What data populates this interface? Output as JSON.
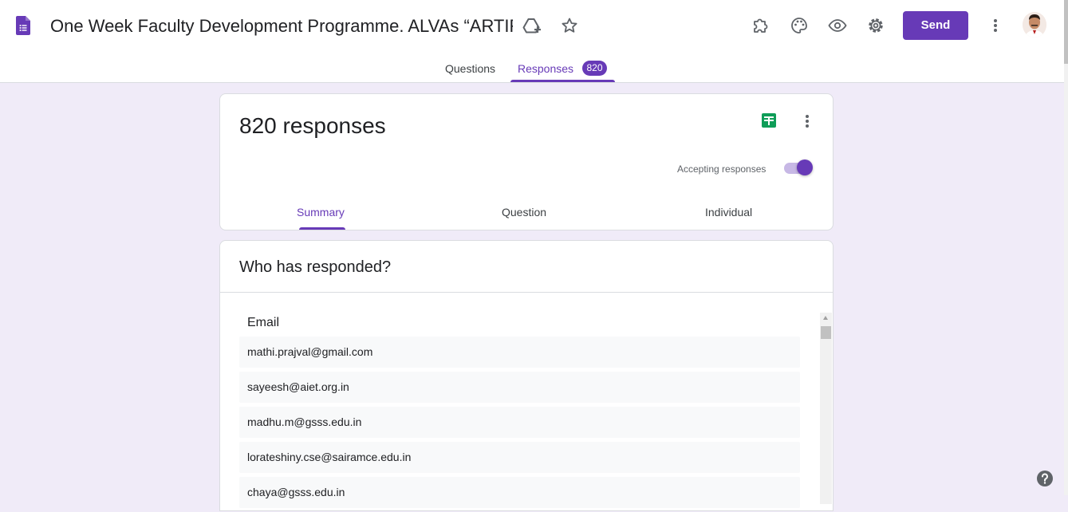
{
  "header": {
    "doc_title": "One Week Faculty Development Programme.  ALVAs “ARTIFICIAL INTELLIGENCE”",
    "send_label": "Send",
    "icons": [
      "google-forms-icon",
      "drive-add-icon",
      "star-icon",
      "addon-puzzle-icon",
      "palette-icon",
      "preview-eye-icon",
      "settings-gear-icon",
      "more-vert-icon",
      "avatar"
    ]
  },
  "tabs": {
    "questions": "Questions",
    "responses": "Responses",
    "responses_count": "820"
  },
  "summary_card": {
    "title": "820 responses",
    "accepting_label": "Accepting responses",
    "accepting_on": true,
    "subtabs": [
      "Summary",
      "Question",
      "Individual"
    ],
    "active_subtab": "Summary"
  },
  "who_card": {
    "title": "Who has responded?",
    "column": "Email",
    "emails": [
      "mathi.prajval@gmail.com",
      "sayeesh@aiet.org.in",
      "madhu.m@gsss.edu.in",
      "lorateshiny.cse@sairamce.edu.in",
      "chaya@gsss.edu.in"
    ]
  },
  "colors": {
    "accent": "#673ab7",
    "background": "#f0ebf8",
    "sheets_green": "#0f9d58"
  }
}
